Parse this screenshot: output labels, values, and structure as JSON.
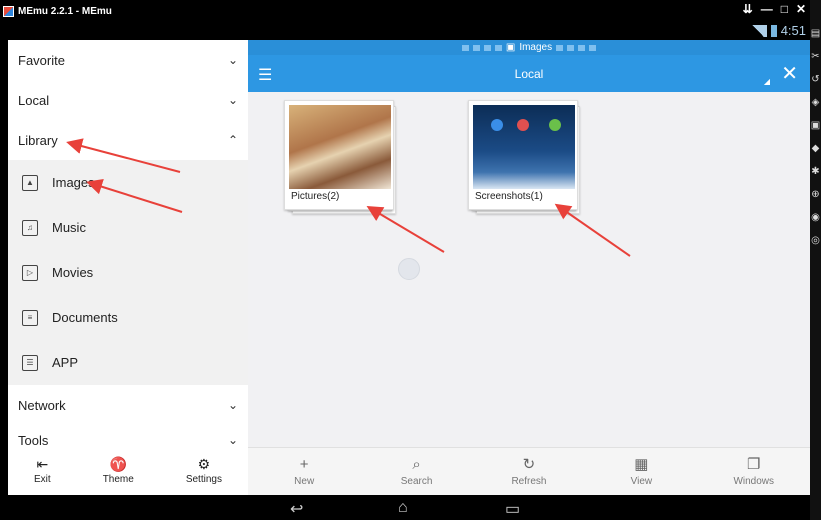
{
  "window": {
    "title": "MEmu 2.2.1 - MEmu",
    "controls": [
      "⇊",
      "—",
      "□",
      "✕"
    ]
  },
  "status": {
    "time": "4:51"
  },
  "drawer": {
    "sections": [
      {
        "label": "Favorite",
        "chevron": "⌄"
      },
      {
        "label": "Local",
        "chevron": "⌄"
      },
      {
        "label": "Library",
        "chevron": "⌃"
      }
    ],
    "library_items": [
      {
        "label": "Images",
        "icon": "image-icon"
      },
      {
        "label": "Music",
        "icon": "music-icon"
      },
      {
        "label": "Movies",
        "icon": "movie-icon"
      },
      {
        "label": "Documents",
        "icon": "document-icon"
      },
      {
        "label": "APP",
        "icon": "app-icon"
      }
    ],
    "more_sections": [
      {
        "label": "Network",
        "chevron": "⌄"
      },
      {
        "label": "Tools",
        "chevron": "⌄"
      }
    ],
    "bottom": [
      {
        "label": "Exit",
        "icon": "exit-icon",
        "glyph": "⇤"
      },
      {
        "label": "Theme",
        "icon": "shirt-icon",
        "glyph": "♈"
      },
      {
        "label": "Settings",
        "icon": "gear-icon",
        "glyph": "⚙"
      }
    ]
  },
  "main": {
    "path_label": "Images",
    "title": "Local",
    "folders": [
      {
        "label": "Pictures(2)"
      },
      {
        "label": "Screenshots(1)"
      }
    ],
    "toolbar": [
      {
        "label": "New",
        "icon": "plus-icon",
        "glyph": "+"
      },
      {
        "label": "Search",
        "icon": "search-icon",
        "glyph": "⌕"
      },
      {
        "label": "Refresh",
        "icon": "refresh-icon",
        "glyph": "↻"
      },
      {
        "label": "View",
        "icon": "grid-icon",
        "glyph": "▦"
      },
      {
        "label": "Windows",
        "icon": "windows-icon",
        "glyph": "❐"
      }
    ]
  },
  "colors": {
    "accent": "#2d97e3",
    "annotation": "#e8413a"
  }
}
